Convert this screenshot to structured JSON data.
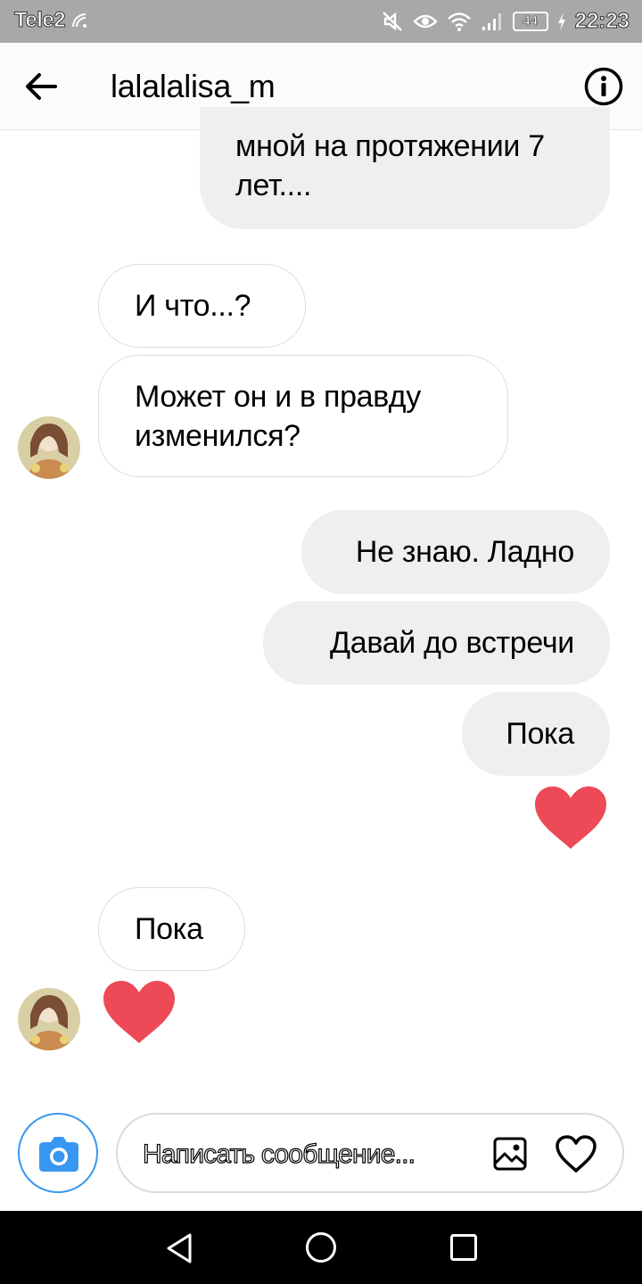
{
  "status_bar": {
    "carrier": "Tele2",
    "battery": "44",
    "time": "22:23",
    "icons": [
      "data-saver-icon",
      "mute-icon",
      "eye-icon",
      "wifi-icon",
      "signal-icon",
      "battery-icon",
      "charging-icon"
    ]
  },
  "header": {
    "username": "lalalalisa_m",
    "back_icon": "arrow-left-icon",
    "info_icon": "info-icon"
  },
  "messages": [
    {
      "side": "out",
      "text": "мной на протяжении 7\nлет...."
    },
    {
      "side": "in",
      "text": "И что...?"
    },
    {
      "side": "in",
      "text": "Может он и в правду\nизменился?"
    },
    {
      "side": "out",
      "text": "Не знаю. Ладно"
    },
    {
      "side": "out",
      "text": "Давай до встречи"
    },
    {
      "side": "out",
      "text": "Пока"
    },
    {
      "side": "out",
      "type": "heart"
    },
    {
      "side": "in",
      "text": "Пока"
    },
    {
      "side": "in",
      "type": "heart"
    }
  ],
  "composer": {
    "placeholder": "Написать сообщение...",
    "camera_icon": "camera-icon",
    "gallery_icon": "image-icon",
    "like_icon": "heart-outline-icon"
  },
  "nav_bar": {
    "icons": [
      "nav-back-icon",
      "nav-home-icon",
      "nav-recents-icon"
    ]
  },
  "colors": {
    "heart": "#ed4956",
    "camera_blue": "#3897f0",
    "outgoing_bubble": "#efefef",
    "status_bar": "#a8a8a8"
  }
}
